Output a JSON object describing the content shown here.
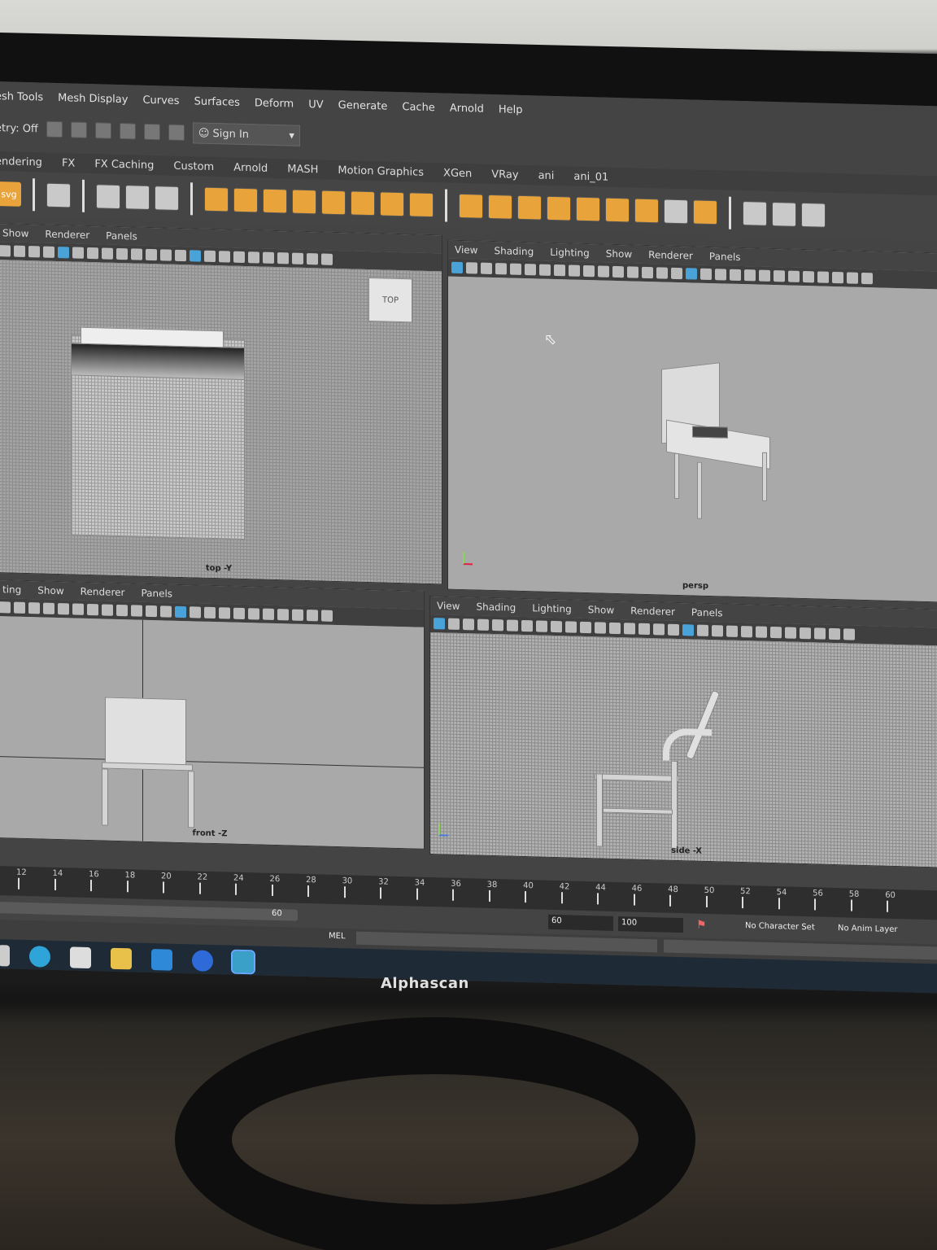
{
  "menu": [
    "esh Tools",
    "Mesh Display",
    "Curves",
    "Surfaces",
    "Deform",
    "UV",
    "Generate",
    "Cache",
    "Arnold",
    "Help"
  ],
  "status": {
    "symmetry": "etry: Off",
    "signin": "Sign In"
  },
  "shelf_tabs": [
    "endering",
    "FX",
    "FX Caching",
    "Custom",
    "Arnold",
    "MASH",
    "Motion Graphics",
    "XGen",
    "VRay",
    "ani",
    "ani_01"
  ],
  "shelf_svg_label": "svg",
  "panels": {
    "top_left": {
      "menu": [
        "Show",
        "Renderer",
        "Panels"
      ],
      "camera": "top -Y",
      "cube_label": "TOP"
    },
    "top_right": {
      "menu": [
        "View",
        "Shading",
        "Lighting",
        "Show",
        "Renderer",
        "Panels"
      ],
      "camera": "persp"
    },
    "bottom_left": {
      "menu": [
        "ting",
        "Show",
        "Renderer",
        "Panels"
      ],
      "camera": "front -Z"
    },
    "bottom_right": {
      "menu": [
        "View",
        "Shading",
        "Lighting",
        "Show",
        "Renderer",
        "Panels"
      ],
      "camera": "side -X"
    }
  },
  "timeline_ticks": [
    "12",
    "14",
    "16",
    "18",
    "20",
    "22",
    "24",
    "26",
    "28",
    "30",
    "32",
    "34",
    "36",
    "38",
    "40",
    "42",
    "44",
    "46",
    "48",
    "50",
    "52",
    "54",
    "56",
    "58",
    "60"
  ],
  "range": {
    "slider_end": "60",
    "end": "60",
    "anim_end": "100",
    "character_set": "No Character Set",
    "anim_layer": "No Anim Layer"
  },
  "mel_label": "MEL",
  "monitor_brand": "Alphascan"
}
